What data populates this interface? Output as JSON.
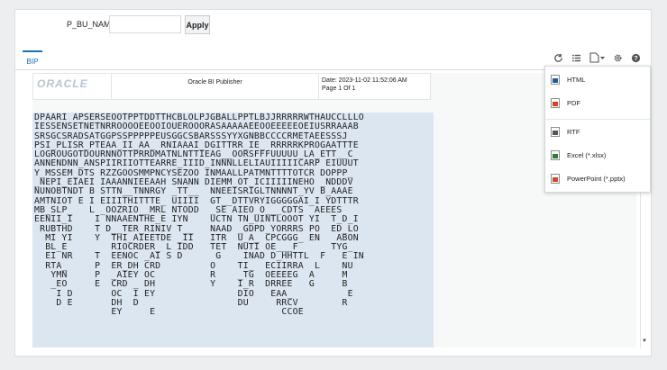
{
  "params": {
    "label": "P_BU_NAME",
    "value": "",
    "apply_label": "Apply"
  },
  "tabs": [
    {
      "label": "BIP",
      "active": true
    }
  ],
  "toolbar": {
    "icons": [
      "refresh-icon",
      "list-icon",
      "export-document-icon",
      "gear-icon",
      "help-icon"
    ]
  },
  "report": {
    "logo_text": "ORACLE",
    "title": "Oracle BI Publisher",
    "date_line": "Date: 2023-11-02 11:52:06 AM",
    "page_line": "Page 1 Of 1"
  },
  "data_lines": [
    "DPAARI APSERSEOOTPPTDDTTHCBLOLPJGBALLPPTLBJJRRRRRWTHAUCCLLLO",
    "IESSENSETNETNRROOOOEEOOIOUEROOORASAAAAAEEOOEEEEEOEIUSRRAAAB",
    "SRSGCSRADSATGGPSSPPPPPEUSGGCSBARSSSYYXGNBBCCCCRMETAEESSSJ",
    "PSI_PLISR_PTEAA_II_AA_ RNIAAAI_DGITTRR_IE_ RRRRRKPROGAATTTE",
    "LOGROUGOTDOURNNOTTPRRDMATNLNTTIEAG__OORSFFFUUUUU_LA_ETT__C",
    "ANNENDNN_ANSPIIRIIOTTEARRE_IIID_INNNLLELIAUIIIIICARP EIUUUT",
    "Y_MSSEM_DTS RZZGOOSMMPNCYSEZOO INMAALLPATMNTTTTOTCR DOPPP_",
    "_NEPI_EIAEI IAAANNIEEAAH SNANN DIEMM_OT_ICIIIIINEHO _NDDDV",
    "NUNOBTNDT B STTN__TNNRGY _TT__  NNEEISRIGLTNNNNT_YV B_AAAE",
    "AMTNIOT E I EIIITHITTTE_ UIIII  GT__DTTVRYIGGGGGAI_I YDTTTR",
    "MB_SLP_   L _OOZRIO__MRL NTODD  _SE AIEO_O___CDTS  AEEES",
    "EENII_I    I NNAAENTHE_E IYN    UCTN TN_UINTLOOOT YI  T_D_I",
    " RUBTHD    T D__TER_RINIV T__   NAAD _GDPD_YORRRS PO  ED_LO",
    "  MI YI    Y  THI_AIEETDE _II   ITR  U_A_ CPCGGG_ EN   ABON",
    "  BL_E        RIOCRDER_ L IDD   TET  NUTI OE___F      TYG_",
    "  EI NR    T  EENOC _AI S D      G    INAD D_HHTTL  F   E IN",
    "  RTA_     P  ER_DH CRD         O    TI_  ECIIRRA  L    NU",
    "   YMN     P  _AIEY OC          R    _TG  OEEEEG  A     M",
    "   _EO     E  CRD _ DH          Y    I_R  DRREE   G     B",
    "    I D       OC  I EY               DIO   EAA_          E",
    "    D E       DH  D                  DU     RRCV        R",
    "              EY     E                       CCOE"
  ],
  "export_menu": [
    {
      "label": "HTML",
      "icon": "html-file-icon",
      "color": "#1f5c99"
    },
    {
      "label": "PDF",
      "icon": "pdf-file-icon",
      "color": "#d6402c"
    },
    {
      "label": "RTF",
      "icon": "rtf-file-icon",
      "color": "#555555"
    },
    {
      "label": "Excel (*.xlsx)",
      "icon": "excel-file-icon",
      "color": "#2f7d32"
    },
    {
      "label": "PowerPoint (*.pptx)",
      "icon": "powerpoint-file-icon",
      "color": "#d24726"
    }
  ]
}
